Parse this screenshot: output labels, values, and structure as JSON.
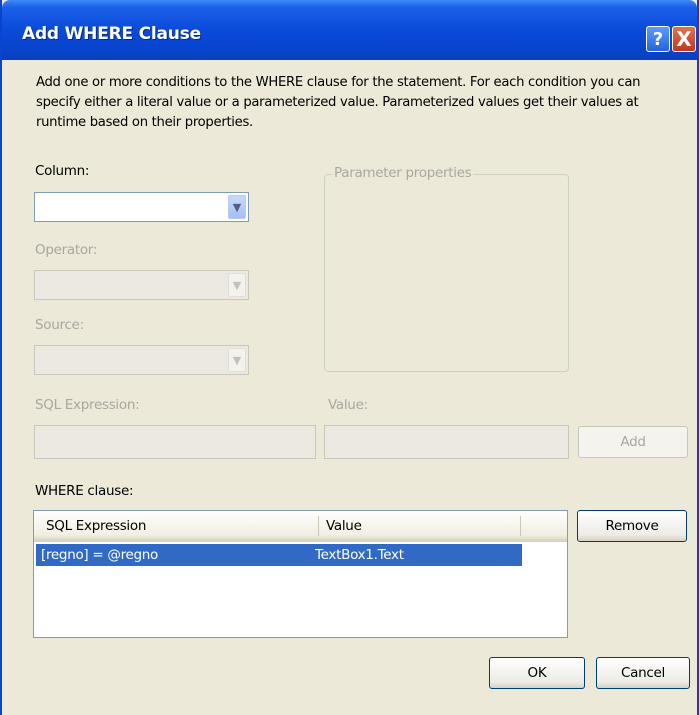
{
  "dialog": {
    "title": "Add WHERE Clause",
    "help_icon": "?",
    "close_icon": "X",
    "description": "Add one or more conditions to the WHERE clause for the statement. For each condition you can specify either a literal value or a parameterized value. Parameterized values get their values at runtime based on their properties."
  },
  "form": {
    "column_label": "Column:",
    "column_value": "",
    "operator_label": "Operator:",
    "operator_value": "",
    "source_label": "Source:",
    "source_value": "",
    "parameter_group_label": "Parameter properties",
    "sql_expression_label": "SQL Expression:",
    "sql_expression_value": "",
    "value_label": "Value:",
    "value_value": "",
    "add_button": "Add"
  },
  "where_clause": {
    "label": "WHERE clause:",
    "columns": [
      "SQL Expression",
      "Value"
    ],
    "rows": [
      {
        "sql_expression": "[regno] = @regno",
        "value": "TextBox1.Text",
        "selected": true
      }
    ],
    "remove_button": "Remove"
  },
  "footer": {
    "ok_button": "OK",
    "cancel_button": "Cancel"
  },
  "colors": {
    "titlebar": "#0a4ad9",
    "dialog_bg": "#ece9d8",
    "selection": "#316ac5",
    "disabled_text": "#a9a7a0"
  },
  "icons": {
    "dropdown": "chevron-down-icon",
    "help": "help-icon",
    "close": "close-icon"
  }
}
